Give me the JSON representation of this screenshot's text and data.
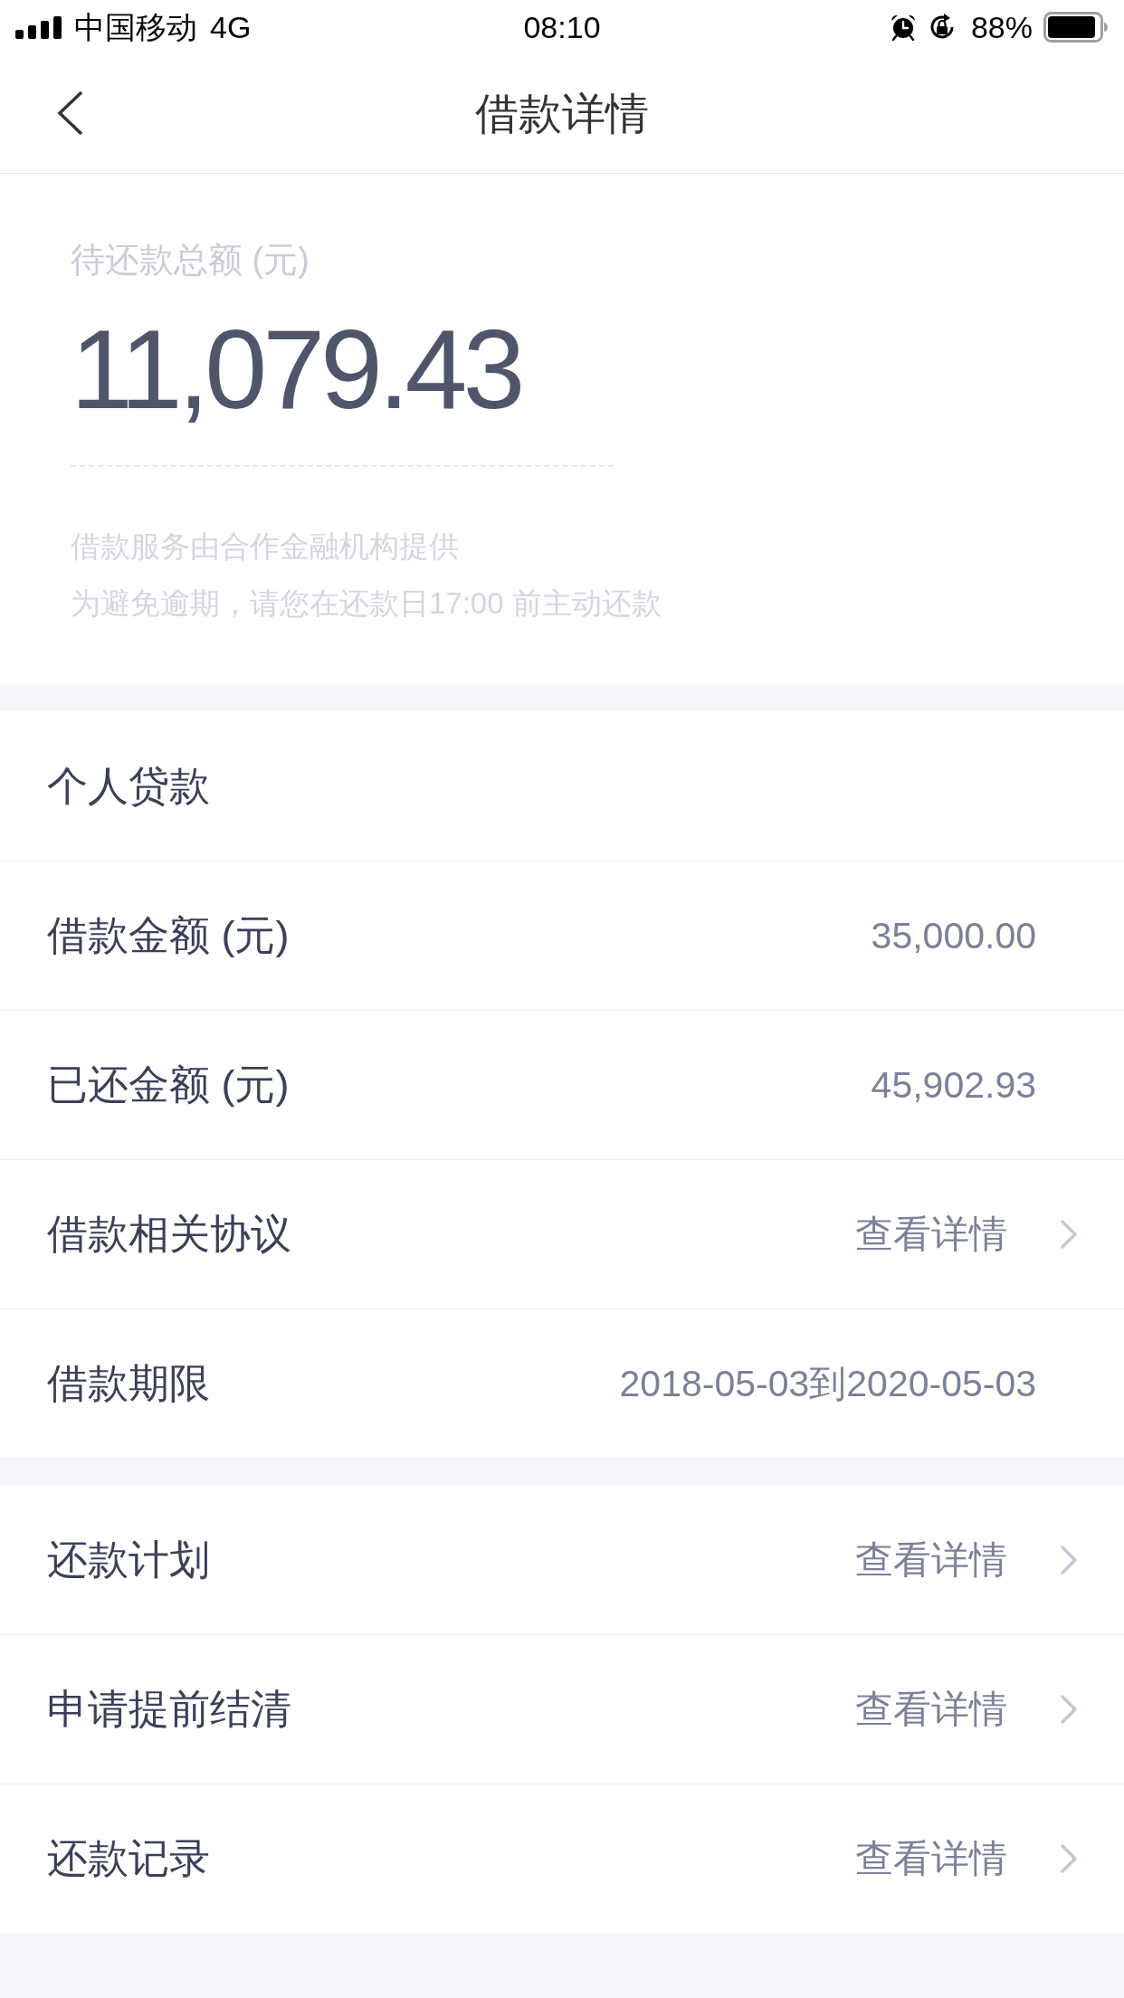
{
  "status_bar": {
    "carrier": "中国移动",
    "network": "4G",
    "time": "08:10",
    "battery": "88%"
  },
  "nav": {
    "title": "借款详情"
  },
  "summary": {
    "label": "待还款总额 (元)",
    "amount": "11,079.43",
    "notes": [
      "借款服务由合作金融机构提供",
      "为避免逾期，请您在还款日17:00 前主动还款"
    ]
  },
  "sections": [
    {
      "title": "个人贷款",
      "rows": [
        {
          "kind": "value",
          "label": "借款金额 (元)",
          "value": "35,000.00"
        },
        {
          "kind": "value",
          "label": "已还金额 (元)",
          "value": "45,902.93"
        },
        {
          "kind": "link",
          "label": "借款相关协议",
          "value": "查看详情"
        },
        {
          "kind": "value",
          "label": "借款期限",
          "value": "2018-05-03到2020-05-03"
        }
      ]
    },
    {
      "rows": [
        {
          "kind": "link",
          "label": "还款计划",
          "value": "查看详情"
        },
        {
          "kind": "link",
          "label": "申请提前结清",
          "value": "查看详情"
        },
        {
          "kind": "link",
          "label": "还款记录",
          "value": "查看详情"
        }
      ]
    }
  ]
}
